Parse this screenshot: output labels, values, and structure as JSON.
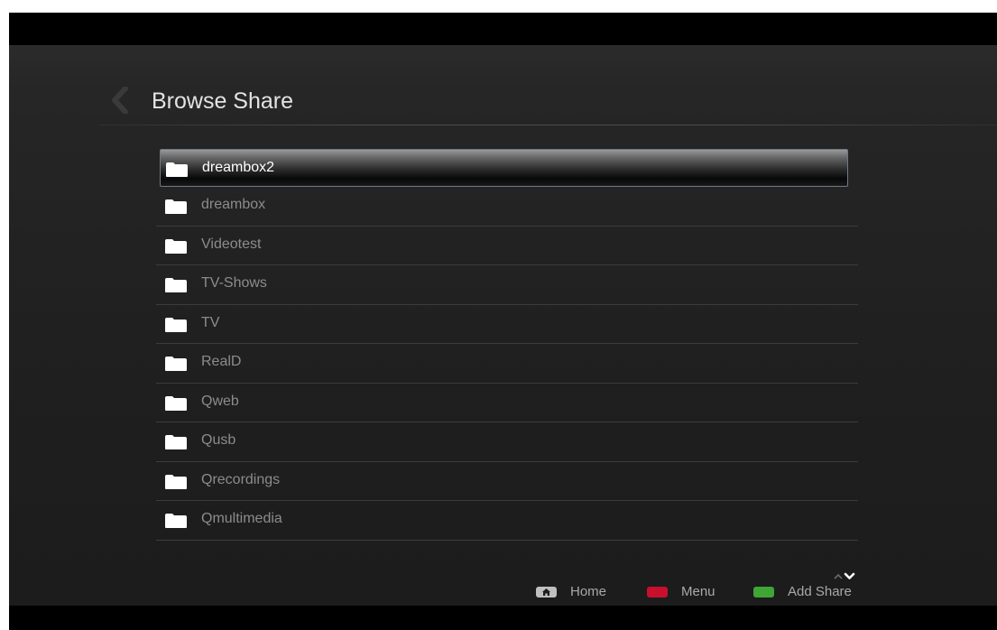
{
  "header": {
    "title": "Browse Share"
  },
  "list": {
    "items": [
      {
        "label": "dreambox2",
        "selected": true
      },
      {
        "label": "dreambox"
      },
      {
        "label": "Videotest"
      },
      {
        "label": "TV-Shows"
      },
      {
        "label": "TV"
      },
      {
        "label": "RealD"
      },
      {
        "label": "Qweb"
      },
      {
        "label": "Qusb"
      },
      {
        "label": "Qrecordings"
      },
      {
        "label": "Qmultimedia"
      }
    ]
  },
  "footer": {
    "home_label": "Home",
    "menu_label": "Menu",
    "add_label": "Add Share",
    "menu_color": "#c8102e",
    "add_color": "#3fa535",
    "home_color": "#bfbfbf"
  },
  "icons": {
    "back": "chevron-left-icon",
    "folder": "folder-icon",
    "home": "home-icon",
    "scroll": "scroll-up-down-icon"
  }
}
